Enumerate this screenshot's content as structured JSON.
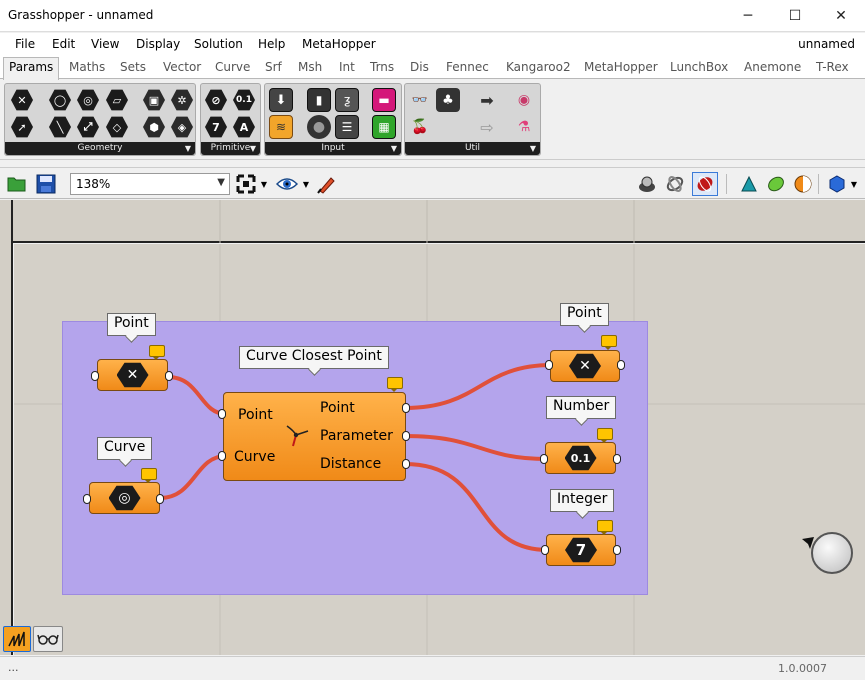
{
  "window": {
    "title": "Grasshopper - unnamed",
    "doc_name": "unnamed",
    "minimize_glyph": "─",
    "maximize_glyph": "☐",
    "close_glyph": "✕"
  },
  "menu": [
    "File",
    "Edit",
    "View",
    "Display",
    "Solution",
    "Help",
    "MetaHopper"
  ],
  "tabs": [
    "Params",
    "Maths",
    "Sets",
    "Vector",
    "Curve",
    "Srf",
    "Msh",
    "Int",
    "Trns",
    "Dis",
    "Fennec",
    "Kangaroo2",
    "MetaHopper",
    "LunchBox",
    "Anemone",
    "T-Rex"
  ],
  "ribbon": {
    "panels": [
      "Geometry",
      "Primitive",
      "Input",
      "Util"
    ],
    "expand_glyph": "▼",
    "primitive_icons": [
      "⊘",
      "0.1",
      "7",
      "A"
    ]
  },
  "toolbar": {
    "zoom": "138%",
    "dropdown_glyph": "▼"
  },
  "canvas": {
    "group_color": "#b4a4ec",
    "wire_color": "#e0503a",
    "component_color": "#f5a030",
    "nodes": {
      "point_in": {
        "label": "Point",
        "glyph": "✕"
      },
      "curve_in": {
        "label": "Curve",
        "glyph": "◎"
      },
      "component": {
        "label": "Curve Closest Point",
        "inputs": [
          "Point",
          "Curve"
        ],
        "outputs": [
          "Point",
          "Parameter",
          "Distance"
        ]
      },
      "point_out": {
        "label": "Point",
        "glyph": "✕"
      },
      "number_out": {
        "label": "Number",
        "glyph": "0.1"
      },
      "integer_out": {
        "label": "Integer",
        "glyph": "7"
      }
    }
  },
  "status": {
    "left": "...",
    "version": "1.0.0007"
  }
}
